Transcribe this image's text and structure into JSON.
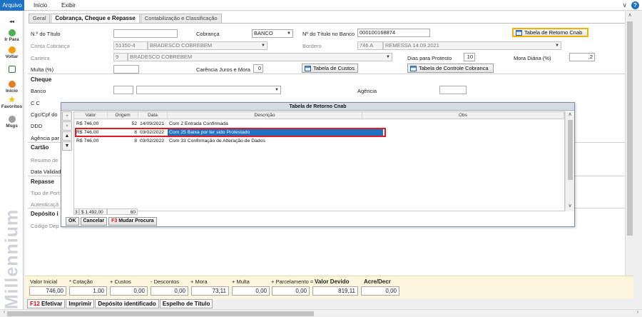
{
  "menubar": {
    "items": [
      "Arquivo",
      "Início",
      "Exibir"
    ]
  },
  "sidebar": {
    "items": [
      {
        "label": "◂◂",
        "icon": "collapse-icon"
      },
      {
        "label": "Ir Para",
        "icon": "go-to-icon"
      },
      {
        "label": "Voltar",
        "icon": "back-icon"
      },
      {
        "label": "",
        "icon": "document-icon"
      },
      {
        "label": "Início",
        "icon": "home-icon"
      },
      {
        "label": "Favoritos",
        "icon": "star-icon"
      },
      {
        "label": "Msgs",
        "icon": "messages-icon"
      }
    ],
    "watermark": "Millennium"
  },
  "tabs": [
    "Geral",
    "Cobrança, Cheque e Repasse",
    "Contabilização e Classificação"
  ],
  "form": {
    "n_titulo_label": "N.º do Título",
    "cobranca_label": "Cobrança",
    "cobranca_value": "BANCO",
    "n_titulo_banco_label": "Nº do Título no Banco",
    "n_titulo_banco_value": "000100168874",
    "btn_retorno": "Tabela de Retorno Cnab",
    "conta_cobranca_label": "Conta Cobrança",
    "conta_code": "51350-4",
    "conta_name": "BRADESCO COBREBEM",
    "bordero_label": "Bordero",
    "bordero_code": "746 A",
    "bordero_name": "REMESSA 14.09.2021",
    "carteira_label": "Carteira",
    "carteira_code": "9",
    "carteira_name": "BRADESCO COBREBEM",
    "dias_protesto_label": "Dias para Protesto",
    "dias_protesto_value": "10",
    "mora_label": "Mora Diária (%)",
    "mora_value": ",2",
    "multa_label": "Multa (%)",
    "carencia_label": "Carência Juros e Mora",
    "carencia_value": "0",
    "btn_custos": "Tabela de Custos",
    "btn_controle": "Tabela de Controle Cobranca",
    "cheque_section": "Cheque",
    "banco_label": "Banco",
    "agencia_label": "Agência",
    "cc_label": "C C",
    "cgc_label": "Cgc/Cpf do",
    "ddd_label": "DDD",
    "agencia_par_label": "Agência par",
    "cartao_section": "Cartão",
    "resumo_label": "Resumo de",
    "data_valid_label": "Data Validad",
    "repasse_section": "Repasse",
    "tipo_label": "Tipo de Port",
    "autenticacao_label": "Autenticaçã",
    "deposito_section": "Depósito i",
    "codigo_dep_label": "Código Dep"
  },
  "dialog": {
    "title": "Tabela de Retorno Cnab",
    "columns": [
      "Valor",
      "Origem",
      "Data",
      "Descrição",
      "Obs"
    ],
    "rows": [
      {
        "valor": "R$ 746,00",
        "origem": "52",
        "data": "14/09/2021",
        "descricao": "Com 2 Entrada Confirmada",
        "obs": ""
      },
      {
        "valor": "R$ 746,00",
        "origem": "8",
        "data": "03/02/2022",
        "descricao": "Com 25 Baixa por ter sido Protestado",
        "obs": ""
      },
      {
        "valor": "R$ 746,00",
        "origem": "8",
        "data": "03/02/2022",
        "descricao": "Com 33 Confirmação de Alteração de Dados",
        "obs": ""
      }
    ],
    "footer_count": "3",
    "footer_total": "$ 1.492,00",
    "footer_origem": "60",
    "btn_ok": "OK",
    "btn_cancelar": "Cancelar",
    "btn_mudar_key": "F3",
    "btn_mudar": "Mudar Procura"
  },
  "totals": {
    "labels": [
      "Valor Inicial",
      "* Cotação",
      "+ Custos",
      "- Descontos",
      "+ Mora",
      "+ Multa",
      "+ Parcelamento =",
      "Valor Devido",
      "Acre/Decr"
    ],
    "values": [
      "746,00",
      "1,00",
      "0,00",
      "0,00",
      "73,11",
      "0,00",
      "0,00",
      "819,11",
      "0,00"
    ]
  },
  "actions": {
    "efetivar_key": "F12",
    "efetivar": "Efetivar",
    "imprimir": "Imprimir",
    "deposito": "Depósito identificado",
    "espelho": "Espelho de Título"
  },
  "colors": {
    "accent": "#1e72c6",
    "highlight_border": "#e01b24",
    "button_focus": "#f0b400"
  }
}
